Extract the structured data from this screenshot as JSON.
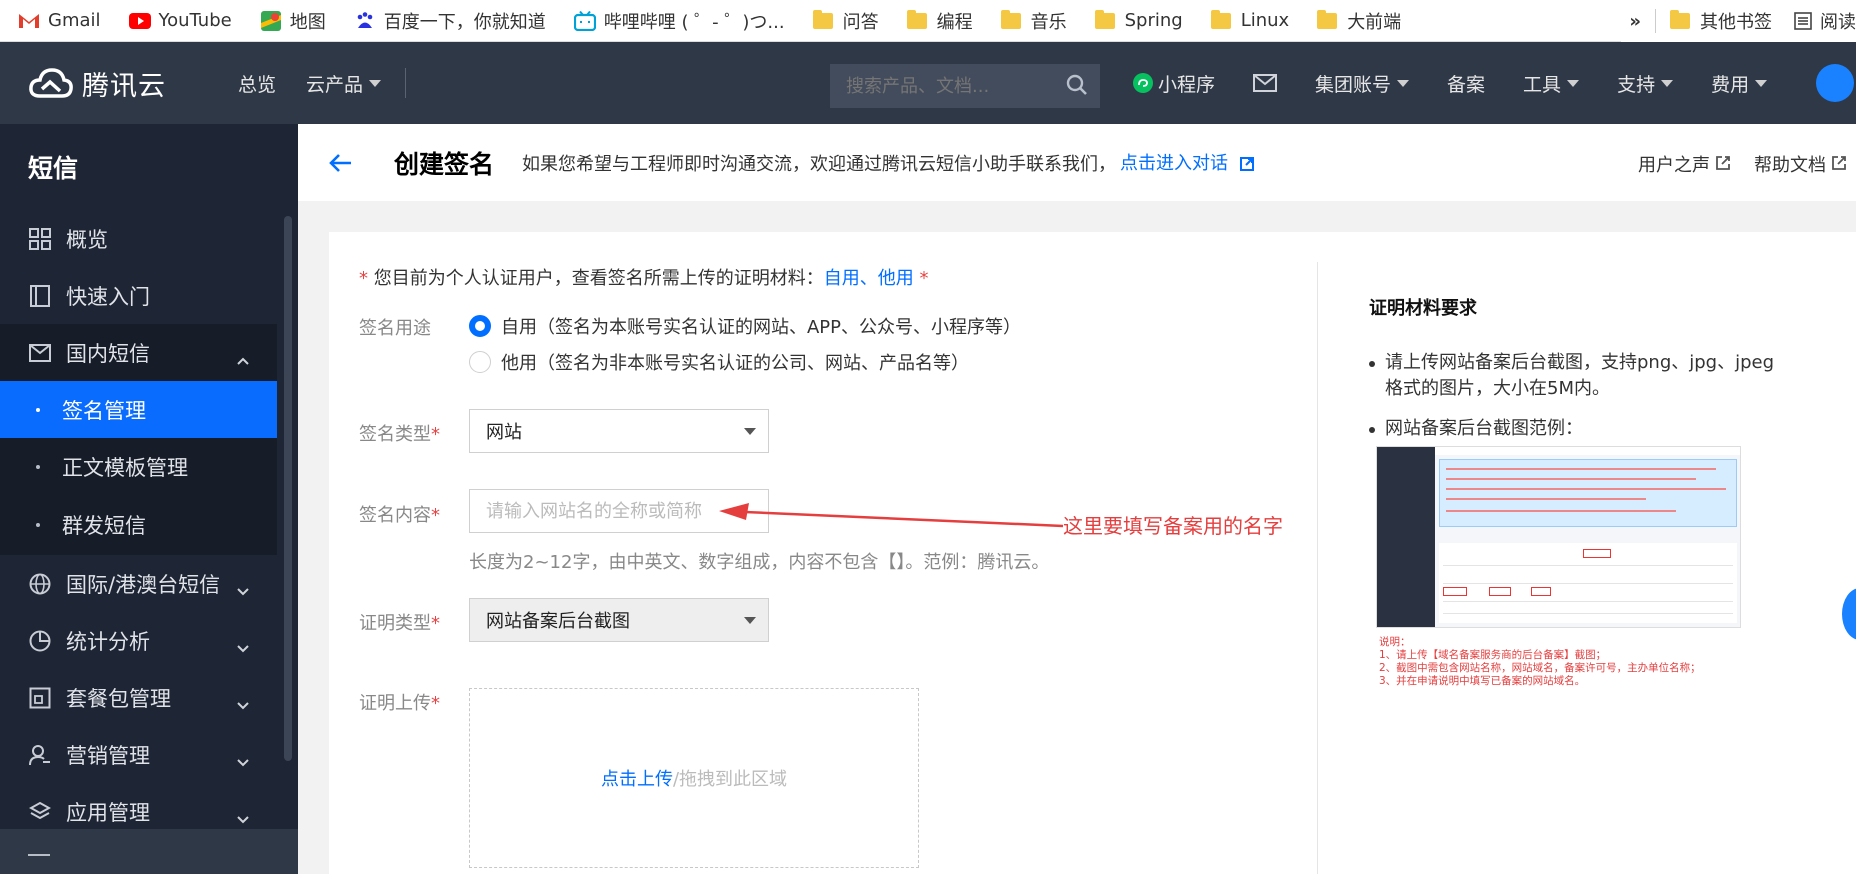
{
  "bookmarks": {
    "items": [
      {
        "label": "Gmail",
        "icon": "gmail-icon"
      },
      {
        "label": "YouTube",
        "icon": "youtube-icon"
      },
      {
        "label": "地图",
        "icon": "maps-icon"
      },
      {
        "label": "百度一下，你就知道",
        "icon": "baidu-icon"
      },
      {
        "label": "哔哩哔哩 ( ゜- ゜)つ...",
        "icon": "bilibili-icon"
      },
      {
        "label": "问答",
        "icon": "folder-icon"
      },
      {
        "label": "编程",
        "icon": "folder-icon"
      },
      {
        "label": "音乐",
        "icon": "folder-icon"
      },
      {
        "label": "Spring",
        "icon": "folder-icon"
      },
      {
        "label": "Linux",
        "icon": "folder-icon"
      },
      {
        "label": "大前端",
        "icon": "folder-icon"
      }
    ],
    "overflow": "»",
    "other": "其他书签",
    "reading": "阅读"
  },
  "topnav": {
    "logo_text": "腾讯云",
    "overview": "总览",
    "products": "云产品",
    "search_placeholder": "搜索产品、文档...",
    "miniprogram": "小程序",
    "group_account": "集团账号",
    "record": "备案",
    "tools": "工具",
    "support": "支持",
    "fees": "费用"
  },
  "sidebar": {
    "title": "短信",
    "items": [
      {
        "label": "概览",
        "icon": "grid-icon"
      },
      {
        "label": "快速入门",
        "icon": "book-icon"
      }
    ],
    "group_open": {
      "label": "国内短信",
      "icon": "mail-icon",
      "subs": [
        "签名管理",
        "正文模板管理",
        "群发短信"
      ]
    },
    "groups": [
      {
        "label": "国际/港澳台短信",
        "icon": "globe-icon"
      },
      {
        "label": "统计分析",
        "icon": "pie-chart-icon"
      },
      {
        "label": "套餐包管理",
        "icon": "package-icon"
      },
      {
        "label": "营销管理",
        "icon": "user-manage-icon"
      },
      {
        "label": "应用管理",
        "icon": "layers-icon"
      }
    ]
  },
  "header": {
    "title": "创建签名",
    "tip": "如果您希望与工程师即时沟通交流，欢迎通过腾讯云短信小助手联系我们，",
    "link": "点击进入对话",
    "user_voice": "用户之声",
    "help_docs": "帮助文档"
  },
  "form": {
    "notice_prefix": "您目前为个人认证用户，查看签名所需上传的证明材料：",
    "notice_self": "自用",
    "notice_sep": "、",
    "notice_other": "他用",
    "purpose_label": "签名用途",
    "purpose_self": "自用（签名为本账号实名认证的网站、APP、公众号、小程序等）",
    "purpose_other": "他用（签名为非本账号实名认证的公司、网站、产品名等）",
    "type_label": "签名类型",
    "type_value": "网站",
    "content_label": "签名内容",
    "content_placeholder": "请输入网站名的全称或简称",
    "content_hint": "长度为2~12字，由中英文、数字组成，内容不包含【】。范例：腾讯云。",
    "cert_type_label": "证明类型",
    "cert_type_value": "网站备案后台截图",
    "upload_label": "证明上传",
    "upload_click": "点击上传",
    "upload_drag": "/拖拽到此区域",
    "required_mark": "*",
    "annotation": "这里要填写备案用的名字"
  },
  "requirements": {
    "title": "证明材料要求",
    "items": [
      "请上传网站备案后台截图，支持png、jpg、jpeg格式的图片，大小在5M内。",
      "网站备案后台截图范例："
    ],
    "notes": [
      "说明：",
      "1、请上传【域名备案服务商的后台备案】截图；",
      "2、截图中需包含网站名称，网站域名，备案许可号，主办单位名称；",
      "3、并在申请说明中填写已备案的网站域名。"
    ]
  },
  "colors": {
    "accent": "#006eff",
    "nav_bg": "#2f3847",
    "sidebar_bg": "#1e2535",
    "annotation": "#e53e3e"
  }
}
